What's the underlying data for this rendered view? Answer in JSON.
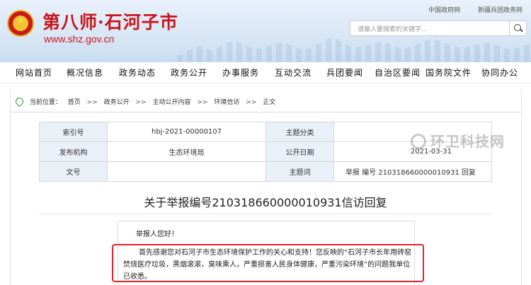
{
  "header": {
    "site_name": "第八师·石河子市",
    "site_url": "www.shz.gov.cn",
    "top_links": [
      "中国政府网",
      "新疆兵团政务网"
    ],
    "search_placeholder": "请输入要搜索的关键字..."
  },
  "nav": {
    "items": [
      "网站首页",
      "概况信息",
      "政务动态",
      "政务公开",
      "办事服务",
      "互动交流",
      "兵团要闻",
      "自治区要闻",
      "国务院文件",
      "协同办公"
    ]
  },
  "breadcrumb": {
    "label": "当前位置：",
    "items": [
      "首页",
      "政务公开",
      "主动公开内容",
      "环境信访",
      "正文"
    ],
    "separator": ">>"
  },
  "meta": {
    "rows": [
      {
        "k1": "索引号",
        "v1": "hbj-2021-00000107",
        "k2": "主题分类",
        "v2": ""
      },
      {
        "k1": "发布机构",
        "v1": "生态环境局",
        "k2": "公开日期",
        "v2": "2021-03-31"
      },
      {
        "k1": "文号",
        "v1": "",
        "k2": "主题词",
        "v2": "举报 编号 210318660000010931 回复"
      }
    ]
  },
  "watermark": "环卫科技网",
  "document": {
    "title": "关于举报编号210318660000010931信访回复",
    "greeting": "举报人您好！",
    "body": "首先感谢您对石河子市生态环境保护工作的关心和支持！您反映的“石河子市长年用砖窑焚烧医疗垃圾，黑烟滚滚，臭味熏人，严重损害人民身体健康，严重污染环境”的问题我单位已收悉。"
  },
  "colors": {
    "brand_red": "#c8161d",
    "highlight_red": "#e0242a",
    "table_key_bg": "#eaf0f8"
  }
}
